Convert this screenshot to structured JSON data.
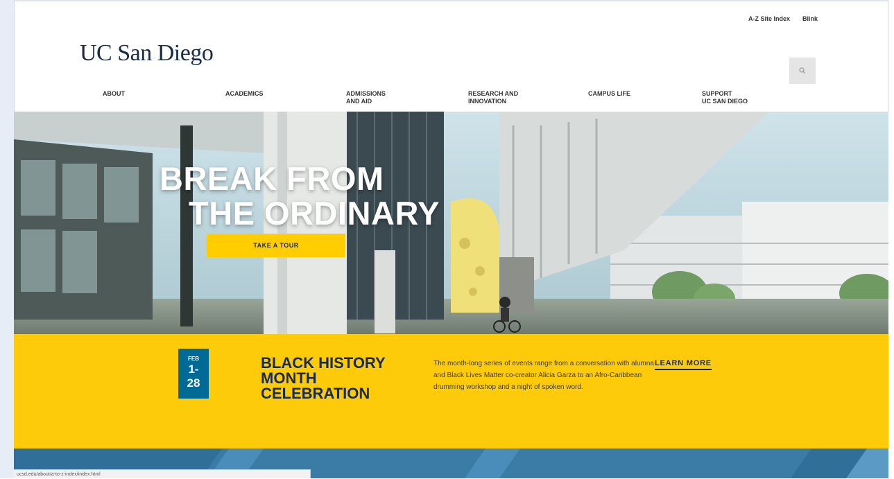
{
  "utility_nav": {
    "site_index": "A-Z Site Index",
    "blink": "Blink"
  },
  "logo": {
    "text": "UC San Diego"
  },
  "icons": {
    "search": "search-icon"
  },
  "nav": {
    "about": [
      "ABOUT"
    ],
    "academics": [
      "ACADEMICS"
    ],
    "admissions": [
      "ADMISSIONS",
      "AND AID"
    ],
    "research": [
      "RESEARCH AND",
      "INNOVATION"
    ],
    "campus": [
      "CAMPUS LIFE"
    ],
    "support": [
      "SUPPORT",
      "UC SAN DIEGO"
    ]
  },
  "hero": {
    "title_line1": "BREAK FROM",
    "title_line2": "THE ORDINARY",
    "cta": "TAKE A TOUR"
  },
  "event": {
    "month": "FEB",
    "day_start": "1-",
    "day_end": "28",
    "title_lines": [
      "BLACK HISTORY",
      "MONTH",
      "CELEBRATION"
    ],
    "description": "The month-long series of events range from a conversation with alumna and Black Lives Matter co-creator Alicia Garza to an Afro-Caribbean drumming workshop and a night of spoken word.",
    "learn_more": "LEARN MORE"
  },
  "status_bar": {
    "url": "ucsd.edu/about/a-to-z-index/index.html"
  },
  "colors": {
    "navy": "#182b49",
    "gold": "#fdcb0a",
    "blue": "#006a96"
  }
}
